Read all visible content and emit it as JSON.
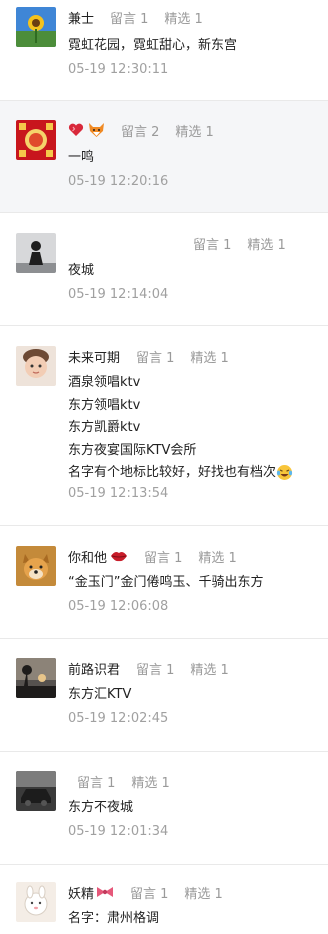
{
  "comments": [
    {
      "nickname": "兼士",
      "replies_label": "留言 1",
      "featured_label": "精选 1",
      "lines": [
        "霓虹花园，霓虹甜心，新东宫"
      ],
      "time": "05-19 12:30:11",
      "avatar": "sunflower-avatar"
    },
    {
      "nickname": "",
      "nick_icons": [
        "heart-icon",
        "fox-icon"
      ],
      "replies_label": "留言 2",
      "featured_label": "精选 1",
      "lines": [
        "一鸣"
      ],
      "time": "05-19 12:20:16",
      "avatar": "red-fortune-avatar"
    },
    {
      "nickname": "",
      "replies_label": "留言 1",
      "featured_label": "精选 1",
      "lines": [
        "夜城"
      ],
      "time": "05-19 12:14:04",
      "avatar": "dark-figure-avatar"
    },
    {
      "nickname": "未来可期",
      "replies_label": "留言 1",
      "featured_label": "精选 1",
      "lines": [
        "酒泉领唱ktv",
        "东方领唱ktv",
        "东方凯爵ktv",
        "东方夜宴国际KTV会所",
        "名字有个地标比较好，好找也有档次"
      ],
      "line_end_icon": "laughing-tears-icon",
      "time": "05-19 12:13:54",
      "avatar": "baby-avatar"
    },
    {
      "nickname": "你和他",
      "nick_icons": [
        "lips-icon"
      ],
      "replies_label": "留言 1",
      "featured_label": "精选 1",
      "lines": [
        "“金玉门”金门倦鸣玉、千骑出东方"
      ],
      "time": "05-19 12:06:08",
      "avatar": "dog-avatar"
    },
    {
      "nickname": "前路识君",
      "replies_label": "留言 1",
      "featured_label": "精选 1",
      "lines": [
        "东方汇KTV"
      ],
      "time": "05-19 12:02:45",
      "avatar": "sunset-avatar"
    },
    {
      "nickname": "",
      "replies_label": "留言 1",
      "featured_label": "精选 1",
      "lines": [
        "东方不夜城"
      ],
      "time": "05-19 12:01:34",
      "avatar": "car-avatar"
    },
    {
      "nickname": "妖精",
      "nick_icons": [
        "ribbon-icon"
      ],
      "replies_label": "留言 1",
      "featured_label": "精选 1",
      "lines": [
        "名字：肃州格调"
      ],
      "time": "",
      "avatar": "cartoon-avatar"
    }
  ],
  "colors": {
    "text": "#222222",
    "meta": "#9a9a9a",
    "divider": "#e9e9e9",
    "highlight_bg": "#f5f6f8"
  }
}
